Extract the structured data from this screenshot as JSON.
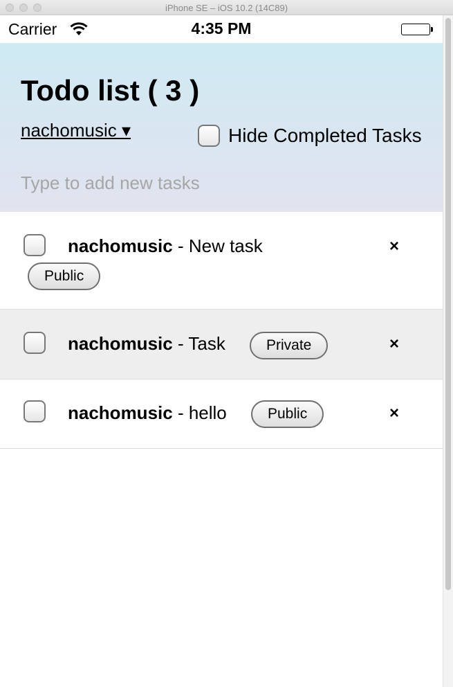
{
  "window": {
    "title": "iPhone SE – iOS 10.2 (14C89)"
  },
  "status_bar": {
    "carrier": "Carrier",
    "time": "4:35 PM",
    "wifi_icon": "wifi-icon",
    "battery_icon": "battery-icon"
  },
  "header": {
    "title": "Todo list ( 3 )",
    "account_label": "nachomusic ▾",
    "hide_completed_label": "Hide Completed Tasks",
    "new_task_placeholder": "Type to add new tasks",
    "colors": {
      "gradient_top": "#cfeaf3",
      "gradient_bottom": "#e1e3ef"
    }
  },
  "tasks": [
    {
      "user": "nachomusic",
      "separator": " - ",
      "text": "New task",
      "visibility": "Public",
      "delete_label": "×",
      "checked": false
    },
    {
      "user": "nachomusic",
      "separator": " - ",
      "text": "Task",
      "visibility": "Private",
      "delete_label": "×",
      "checked": false
    },
    {
      "user": "nachomusic",
      "separator": " - ",
      "text": "hello",
      "visibility": "Public",
      "delete_label": "×",
      "checked": false
    }
  ]
}
